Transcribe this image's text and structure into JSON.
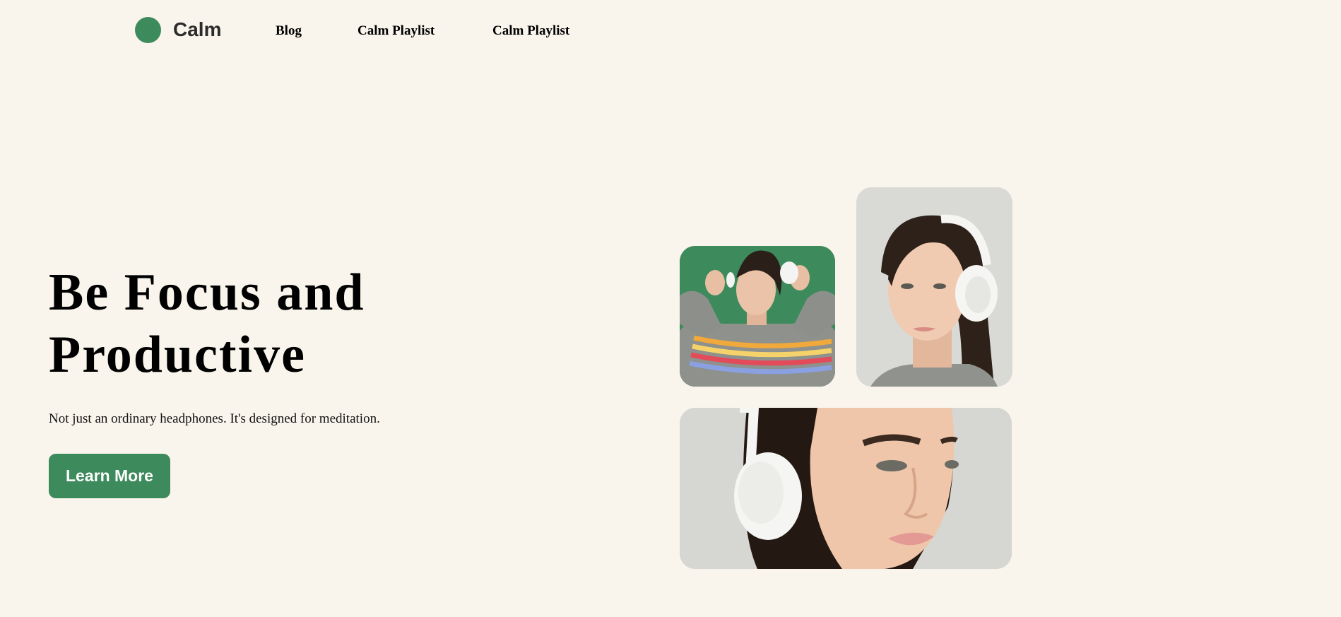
{
  "nav": {
    "brand": "Calm",
    "links": [
      "Blog",
      "Calm Playlist",
      "Calm Playlist"
    ]
  },
  "hero": {
    "title_line1": "Be Focus and",
    "title_line2": "Productive",
    "subtitle": "Not just an ordinary headphones. It's designed for meditation.",
    "cta_label": "Learn More"
  },
  "colors": {
    "accent": "#3d8a5c",
    "background": "#f9f5ec"
  },
  "gallery": {
    "photos": [
      "woman-green-bg-headphones",
      "woman-profile-headphones",
      "woman-closeup-headphones"
    ]
  }
}
